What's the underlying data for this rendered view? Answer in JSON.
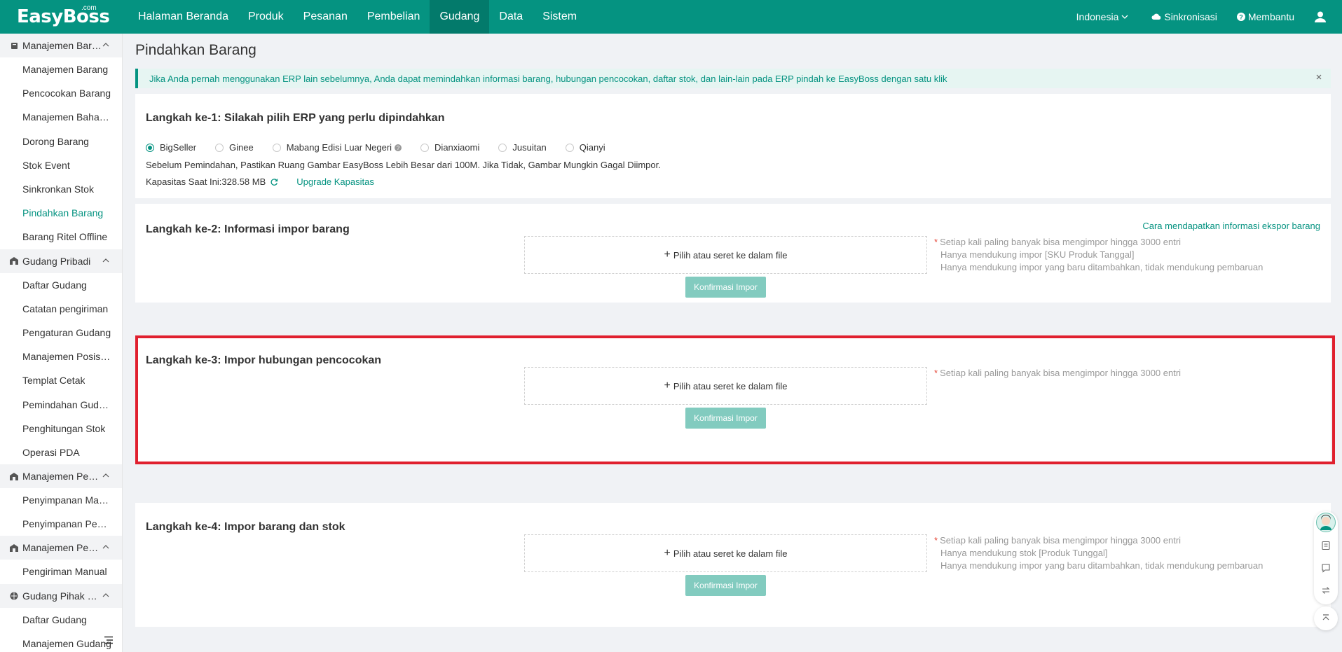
{
  "brand": {
    "name": "EasyBoss",
    "suffix": ".com"
  },
  "nav": {
    "items": [
      {
        "label": "Halaman Beranda"
      },
      {
        "label": "Produk"
      },
      {
        "label": "Pesanan"
      },
      {
        "label": "Pembelian"
      },
      {
        "label": "Gudang"
      },
      {
        "label": "Data"
      },
      {
        "label": "Sistem"
      }
    ],
    "active": "Gudang"
  },
  "top_right": {
    "country": "Indonesia",
    "sync": "Sinkronisasi",
    "help": "Membantu"
  },
  "sidebar": {
    "groups": [
      {
        "label": "Manajemen Barang",
        "items": [
          "Manajemen Barang",
          "Pencocokan Barang",
          "Manajemen Bahan Baku",
          "Dorong Barang",
          "Stok Event",
          "Sinkronkan Stok",
          "Pindahkan Barang",
          "Barang Ritel Offline"
        ]
      },
      {
        "label": "Gudang Pribadi",
        "items": [
          "Daftar Gudang",
          "Catatan pengiriman",
          "Pengaturan Gudang",
          "Manajemen Posisi Rak",
          "Templat Cetak",
          "Pemindahan Gudang",
          "Penghitungan Stok",
          "Operasi PDA"
        ]
      },
      {
        "label": "Manajemen Penyimpanan",
        "items": [
          "Penyimpanan Manual",
          "Penyimpanan Pengadaan"
        ]
      },
      {
        "label": "Manajemen Pengiriman",
        "items": [
          "Pengiriman Manual"
        ]
      },
      {
        "label": "Gudang Pihak Ketiga",
        "items": [
          "Daftar Gudang",
          "Manajemen Gudang"
        ]
      }
    ],
    "active_item": "Pindahkan Barang"
  },
  "page": {
    "title": "Pindahkan Barang",
    "alert": "Jika Anda pernah menggunakan ERP lain sebelumnya, Anda dapat memindahkan informasi barang, hubungan pencocokan, daftar stok, dan lain-lain pada ERP pindah ke EasyBoss dengan satu klik"
  },
  "step1": {
    "title": "Langkah ke-1: Silakah pilih ERP yang perlu dipindahkan",
    "options": [
      "BigSeller",
      "Ginee",
      "Mabang Edisi Luar Negeri",
      "Dianxiaomi",
      "Jusuitan",
      "Qianyi"
    ],
    "selected": "BigSeller",
    "note": "Sebelum Pemindahan, Pastikan Ruang Gambar EasyBoss Lebih Besar dari 100M. Jika Tidak, Gambar Mungkin Gagal Diimpor.",
    "capacity": "Kapasitas Saat Ini:328.58 MB",
    "upgrade": "Upgrade Kapasitas"
  },
  "step2": {
    "title": "Langkah ke-2: Informasi impor barang",
    "link": "Cara mendapatkan informasi ekspor barang",
    "upload": "Pilih atau seret ke dalam file",
    "button": "Konfirmasi Impor",
    "hints": [
      "Setiap kali paling banyak bisa mengimpor hingga 3000 entri",
      "Hanya mendukung impor [SKU Produk Tanggal]",
      "Hanya mendukung impor yang baru ditambahkan, tidak mendukung pembaruan"
    ]
  },
  "step3": {
    "title": "Langkah ke-3: Impor hubungan pencocokan",
    "upload": "Pilih atau seret ke dalam file",
    "button": "Konfirmasi Impor",
    "hints": [
      "Setiap kali paling banyak bisa mengimpor hingga 3000 entri"
    ]
  },
  "step4": {
    "title": "Langkah ke-4: Impor barang dan stok",
    "upload": "Pilih atau seret ke dalam file",
    "button": "Konfirmasi Impor",
    "hints": [
      "Setiap kali paling banyak bisa mengimpor hingga 3000 entri",
      "Hanya mendukung stok [Produk Tunggal]",
      "Hanya mendukung impor yang baru ditambahkan, tidak mendukung pembaruan"
    ]
  },
  "colors": {
    "brand": "#059381",
    "highlight": "#e0202e",
    "button_disabled": "#82cbbf"
  }
}
